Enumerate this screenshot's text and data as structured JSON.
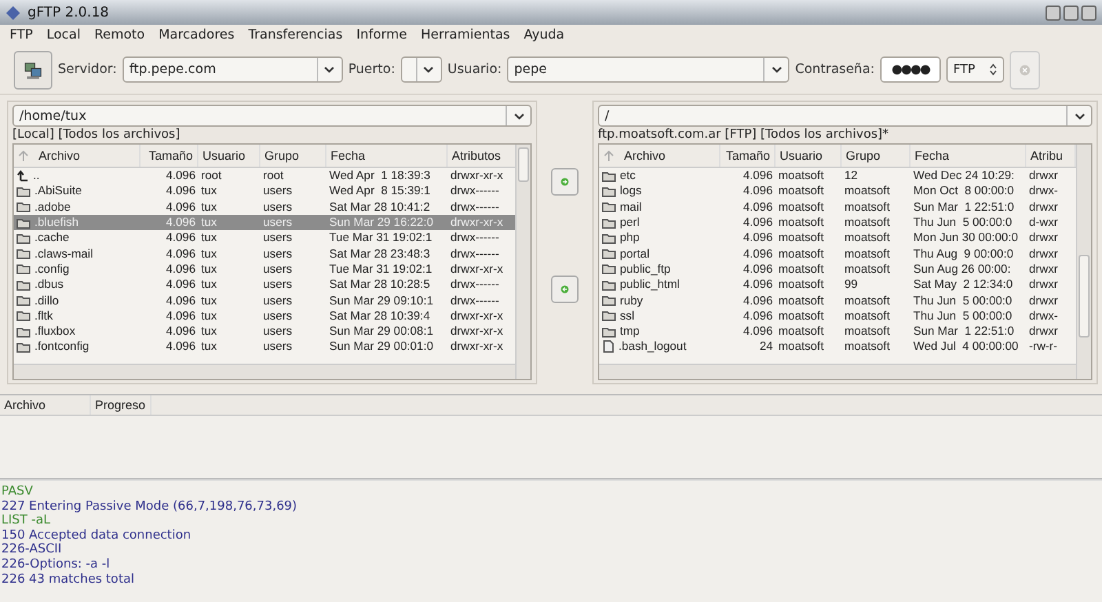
{
  "window": {
    "title": "gFTP 2.0.18"
  },
  "menu": [
    "FTP",
    "Local",
    "Remoto",
    "Marcadores",
    "Transferencias",
    "Informe",
    "Herramientas",
    "Ayuda"
  ],
  "toolbar": {
    "server_label": "Servidor:",
    "server": "ftp.pepe.com",
    "port_label": "Puerto:",
    "user_label": "Usuario:",
    "user": "pepe",
    "password_label": "Contraseña:",
    "password": "●●●●",
    "protocol": "FTP"
  },
  "local": {
    "path": "/home/tux",
    "status": "[Local] [Todos los archivos]",
    "columns": [
      "Archivo",
      "Tamaño",
      "Usuario",
      "Grupo",
      "Fecha",
      "Atributos"
    ],
    "rows": [
      {
        "kind": "up",
        "selected": false,
        "cells": [
          "..",
          "4.096",
          "root",
          "root",
          "Wed Apr  1 18:39:3",
          "drwxr-xr-x"
        ]
      },
      {
        "kind": "folder",
        "selected": false,
        "cells": [
          ".AbiSuite",
          "4.096",
          "tux",
          "users",
          "Wed Apr  8 15:39:1",
          "drwx------"
        ]
      },
      {
        "kind": "folder",
        "selected": false,
        "cells": [
          ".adobe",
          "4.096",
          "tux",
          "users",
          "Sat Mar 28 10:41:2",
          "drwx------"
        ]
      },
      {
        "kind": "folder",
        "selected": true,
        "cells": [
          ".bluefish",
          "4.096",
          "tux",
          "users",
          "Sun Mar 29 16:22:0",
          "drwxr-xr-x"
        ]
      },
      {
        "kind": "folder",
        "selected": false,
        "cells": [
          ".cache",
          "4.096",
          "tux",
          "users",
          "Tue Mar 31 19:02:1",
          "drwx------"
        ]
      },
      {
        "kind": "folder",
        "selected": false,
        "cells": [
          ".claws-mail",
          "4.096",
          "tux",
          "users",
          "Sat Mar 28 23:48:3",
          "drwx------"
        ]
      },
      {
        "kind": "folder",
        "selected": false,
        "cells": [
          ".config",
          "4.096",
          "tux",
          "users",
          "Tue Mar 31 19:02:1",
          "drwxr-xr-x"
        ]
      },
      {
        "kind": "folder",
        "selected": false,
        "cells": [
          ".dbus",
          "4.096",
          "tux",
          "users",
          "Sat Mar 28 10:28:5",
          "drwx------"
        ]
      },
      {
        "kind": "folder",
        "selected": false,
        "cells": [
          ".dillo",
          "4.096",
          "tux",
          "users",
          "Sun Mar 29 09:10:1",
          "drwx------"
        ]
      },
      {
        "kind": "folder",
        "selected": false,
        "cells": [
          ".fltk",
          "4.096",
          "tux",
          "users",
          "Sat Mar 28 10:39:4",
          "drwxr-xr-x"
        ]
      },
      {
        "kind": "folder",
        "selected": false,
        "cells": [
          ".fluxbox",
          "4.096",
          "tux",
          "users",
          "Sun Mar 29 00:08:1",
          "drwxr-xr-x"
        ]
      },
      {
        "kind": "folder",
        "selected": false,
        "cells": [
          ".fontconfig",
          "4.096",
          "tux",
          "users",
          "Sun Mar 29 00:01:0",
          "drwxr-xr-x"
        ]
      }
    ]
  },
  "remote": {
    "path": "/",
    "status": "ftp.moatsoft.com.ar [FTP] [Todos los archivos]*",
    "columns": [
      "Archivo",
      "Tamaño",
      "Usuario",
      "Grupo",
      "Fecha",
      "Atribu"
    ],
    "rows": [
      {
        "kind": "folder",
        "selected": false,
        "cells": [
          "etc",
          "4.096",
          "moatsoft",
          "12",
          "Wed Dec 24 10:29:",
          "drwxr"
        ]
      },
      {
        "kind": "folder",
        "selected": false,
        "cells": [
          "logs",
          "4.096",
          "moatsoft",
          "moatsoft",
          "Mon Oct  8 00:00:0",
          "drwx-"
        ]
      },
      {
        "kind": "folder",
        "selected": false,
        "cells": [
          "mail",
          "4.096",
          "moatsoft",
          "moatsoft",
          "Sun Mar  1 22:51:0",
          "drwxr"
        ]
      },
      {
        "kind": "folder",
        "selected": false,
        "cells": [
          "perl",
          "4.096",
          "moatsoft",
          "moatsoft",
          "Thu Jun  5 00:00:0",
          "d-wxr"
        ]
      },
      {
        "kind": "folder",
        "selected": false,
        "cells": [
          "php",
          "4.096",
          "moatsoft",
          "moatsoft",
          "Mon Jun 30 00:00:0",
          "drwxr"
        ]
      },
      {
        "kind": "folder",
        "selected": false,
        "cells": [
          "portal",
          "4.096",
          "moatsoft",
          "moatsoft",
          "Thu Aug  9 00:00:0",
          "drwxr"
        ]
      },
      {
        "kind": "folder",
        "selected": false,
        "cells": [
          "public_ftp",
          "4.096",
          "moatsoft",
          "moatsoft",
          "Sun Aug 26 00:00:",
          "drwxr"
        ]
      },
      {
        "kind": "folder",
        "selected": false,
        "cells": [
          "public_html",
          "4.096",
          "moatsoft",
          "99",
          "Sat May  2 12:34:0",
          "drwxr"
        ]
      },
      {
        "kind": "folder",
        "selected": false,
        "cells": [
          "ruby",
          "4.096",
          "moatsoft",
          "moatsoft",
          "Thu Jun  5 00:00:0",
          "drwxr"
        ]
      },
      {
        "kind": "folder",
        "selected": false,
        "cells": [
          "ssl",
          "4.096",
          "moatsoft",
          "moatsoft",
          "Thu Jun  5 00:00:0",
          "drwx-"
        ]
      },
      {
        "kind": "folder",
        "selected": false,
        "cells": [
          "tmp",
          "4.096",
          "moatsoft",
          "moatsoft",
          "Sun Mar  1 22:51:0",
          "drwxr"
        ]
      },
      {
        "kind": "file",
        "selected": false,
        "cells": [
          ".bash_logout",
          "24",
          "moatsoft",
          "moatsoft",
          "Wed Jul  4 00:00:00",
          "-rw-r-"
        ]
      }
    ]
  },
  "transfers": {
    "columns": [
      "Archivo",
      "Progreso"
    ]
  },
  "log": [
    {
      "kind": "command",
      "text": "PASV"
    },
    {
      "kind": "response",
      "text": "227 Entering Passive Mode (66,7,198,76,73,69)"
    },
    {
      "kind": "command",
      "text": "LIST -aL"
    },
    {
      "kind": "response",
      "text": "150 Accepted data connection"
    },
    {
      "kind": "response",
      "text": "226-ASCII"
    },
    {
      "kind": "response",
      "text": "226-Options: -a -l"
    },
    {
      "kind": "response",
      "text": "226 43 matches total"
    }
  ]
}
